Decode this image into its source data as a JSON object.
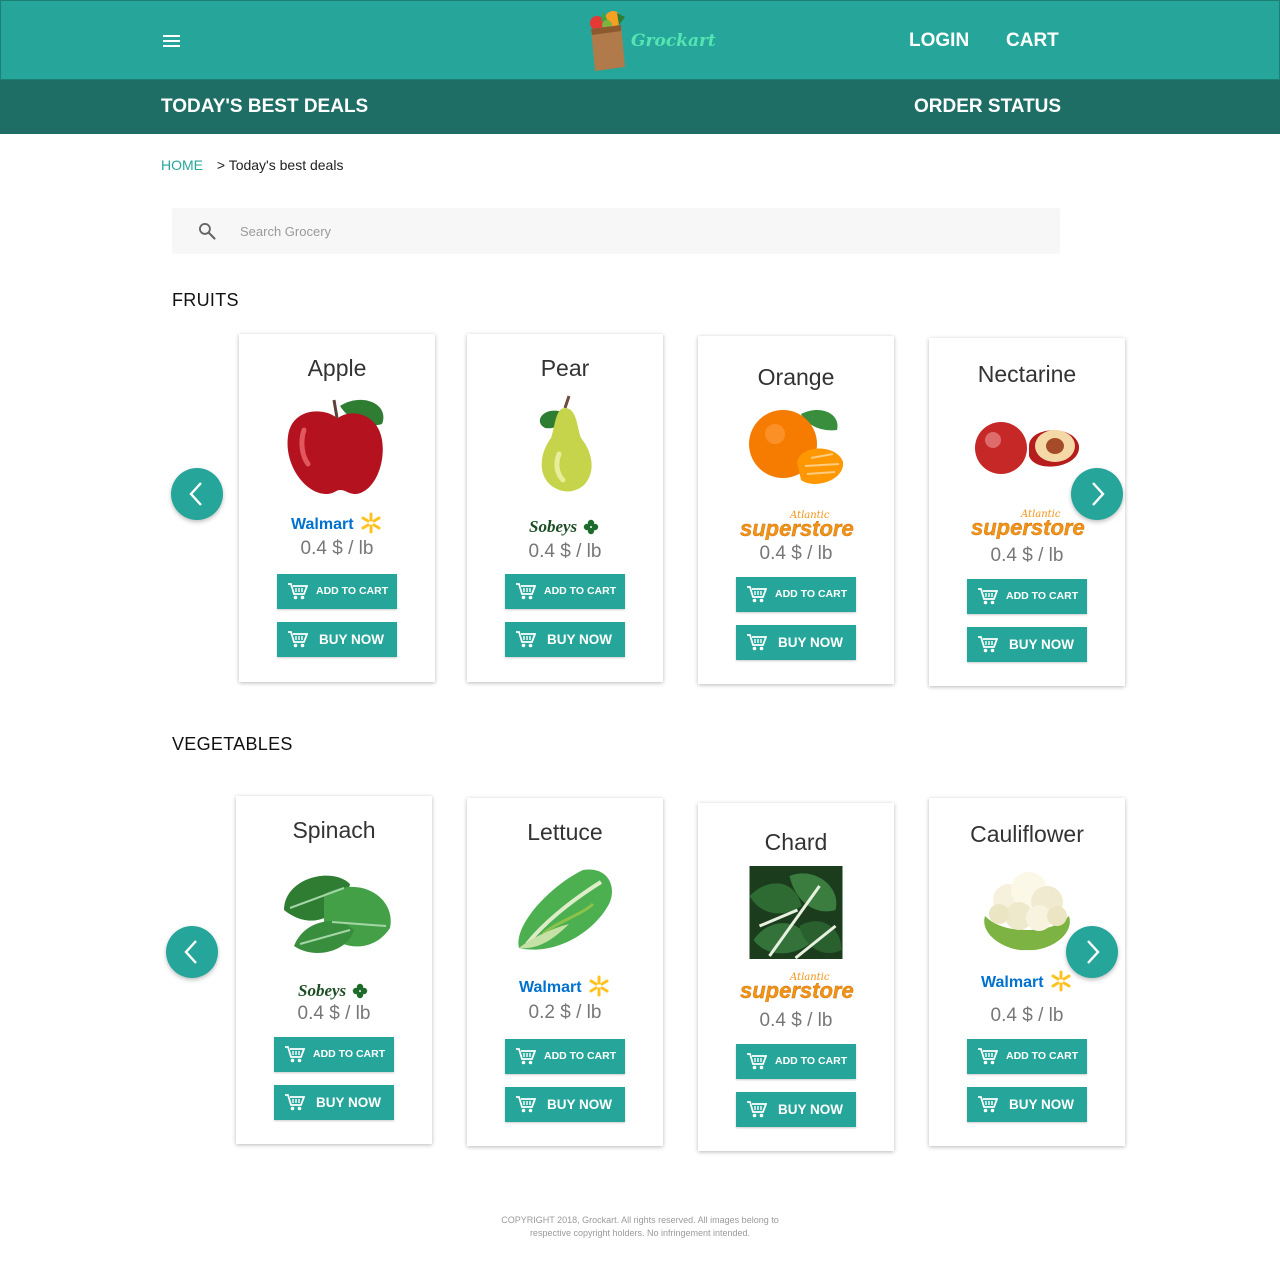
{
  "header": {
    "logo_text": "Grockart",
    "login": "LOGIN",
    "cart": "CART"
  },
  "subnav": {
    "deals": "TODAY'S BEST DEALS",
    "order_status": "ORDER STATUS"
  },
  "breadcrumb": {
    "home": "HOME",
    "current": "> Today's best deals"
  },
  "search": {
    "placeholder": "Search Grocery"
  },
  "buttons": {
    "add_to_cart": "ADD TO CART",
    "buy_now": "BUY NOW"
  },
  "sections": [
    {
      "title": "FRUITS",
      "items": [
        {
          "name": "Apple",
          "store": "Walmart",
          "price": "0.4 $ / lb"
        },
        {
          "name": "Pear",
          "store": "Sobeys",
          "price": "0.4 $ / lb"
        },
        {
          "name": "Orange",
          "store": "Atlantic Superstore",
          "price": "0.4 $ / lb"
        },
        {
          "name": "Nectarine",
          "store": "Atlantic Superstore",
          "price": "0.4 $ / lb"
        }
      ]
    },
    {
      "title": "VEGETABLES",
      "items": [
        {
          "name": "Spinach",
          "store": "Sobeys",
          "price": "0.4 $ / lb"
        },
        {
          "name": "Lettuce",
          "store": "Walmart",
          "price": "0.2 $ / lb"
        },
        {
          "name": "Chard",
          "store": "Atlantic Superstore",
          "price": "0.4 $ / lb"
        },
        {
          "name": "Cauliflower",
          "store": "Walmart",
          "price": "0.4 $ / lb"
        }
      ]
    }
  ],
  "logos": {
    "walmart": "Walmart",
    "sobeys": "Sobeys",
    "superstore_top": "Atlantic",
    "superstore_main": "superstore"
  },
  "footer": {
    "line1": "COPYRIGHT 2018, Grockart. All rights reserved. All images belong to",
    "line2": "respective copyright holders. No infringement intended."
  },
  "colors": {
    "primary": "#26a69a",
    "primary_dark": "#1e6e66",
    "walmart_blue": "#0071ce",
    "walmart_yellow": "#ffc220",
    "sobeys_green": "#1c6b2a",
    "superstore_orange": "#f39314"
  }
}
